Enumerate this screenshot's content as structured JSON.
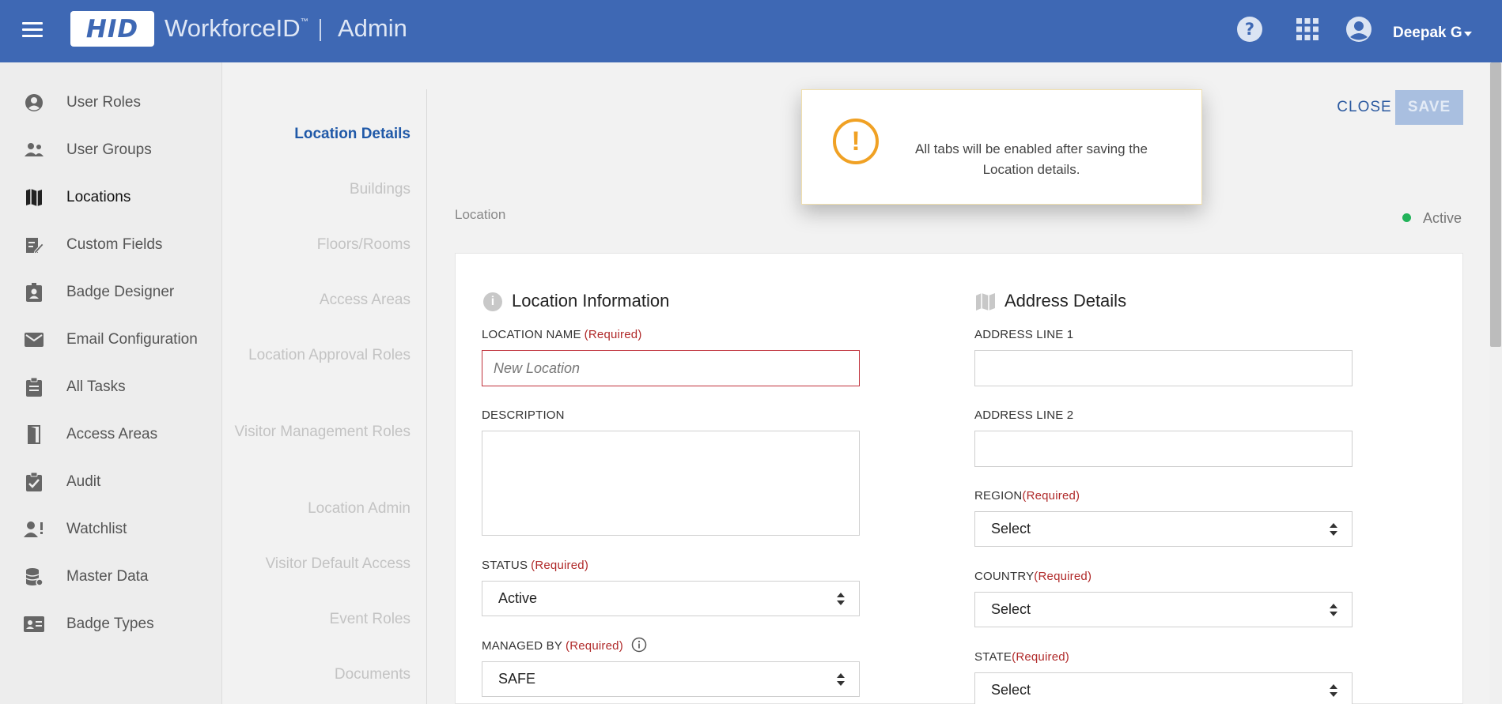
{
  "header": {
    "logo_text": "HID",
    "brand": "WorkforceID",
    "trademark": "™",
    "section": "Admin",
    "user_name": "Deepak G",
    "bg_color": "#3e68b4"
  },
  "sidebar": {
    "items": [
      {
        "label": "User Roles",
        "icon": "user-circle-icon"
      },
      {
        "label": "User Groups",
        "icon": "user-group-icon"
      },
      {
        "label": "Locations",
        "icon": "map-icon",
        "active": true
      },
      {
        "label": "Custom Fields",
        "icon": "edit-document-icon"
      },
      {
        "label": "Badge Designer",
        "icon": "badge-icon"
      },
      {
        "label": "Email Configuration",
        "icon": "envelope-icon"
      },
      {
        "label": "All Tasks",
        "icon": "clipboard-icon"
      },
      {
        "label": "Access Areas",
        "icon": "door-icon"
      },
      {
        "label": "Audit",
        "icon": "clipboard-check-icon"
      },
      {
        "label": "Watchlist",
        "icon": "user-alert-icon"
      },
      {
        "label": "Master Data",
        "icon": "database-icon"
      },
      {
        "label": "Badge Types",
        "icon": "id-card-icon"
      }
    ]
  },
  "tabs": [
    {
      "label": "Location Details",
      "active": true
    },
    {
      "label": "Buildings"
    },
    {
      "label": "Floors/Rooms"
    },
    {
      "label": "Access Areas"
    },
    {
      "label": "Location Approval Roles"
    },
    {
      "label": "Visitor Management Roles"
    },
    {
      "label": "Location Admin"
    },
    {
      "label": "Visitor Default Access"
    },
    {
      "label": "Event Roles"
    },
    {
      "label": "Documents"
    }
  ],
  "actions": {
    "close_label": "CLOSE",
    "save_label": "SAVE"
  },
  "content": {
    "section_label": "Location",
    "status_text": "Active",
    "status_color": "#22b35a"
  },
  "toast": {
    "message": "All tabs will be enabled after saving the Location details.",
    "accent_color": "#f0a124"
  },
  "location_info": {
    "title": "Location Information",
    "required_text": "(Required)",
    "name_label": "LOCATION NAME",
    "name_placeholder": "New Location",
    "description_label": "DESCRIPTION",
    "status_label": "STATUS",
    "status_value": "Active",
    "managed_by_label": "MANAGED BY",
    "managed_by_value": "SAFE"
  },
  "address": {
    "title": "Address Details",
    "line1_label": "ADDRESS LINE 1",
    "line2_label": "ADDRESS LINE 2",
    "region_label": "REGION",
    "region_value": "Select",
    "country_label": "COUNTRY",
    "country_value": "Select",
    "state_label": "STATE",
    "state_value": "Select"
  }
}
